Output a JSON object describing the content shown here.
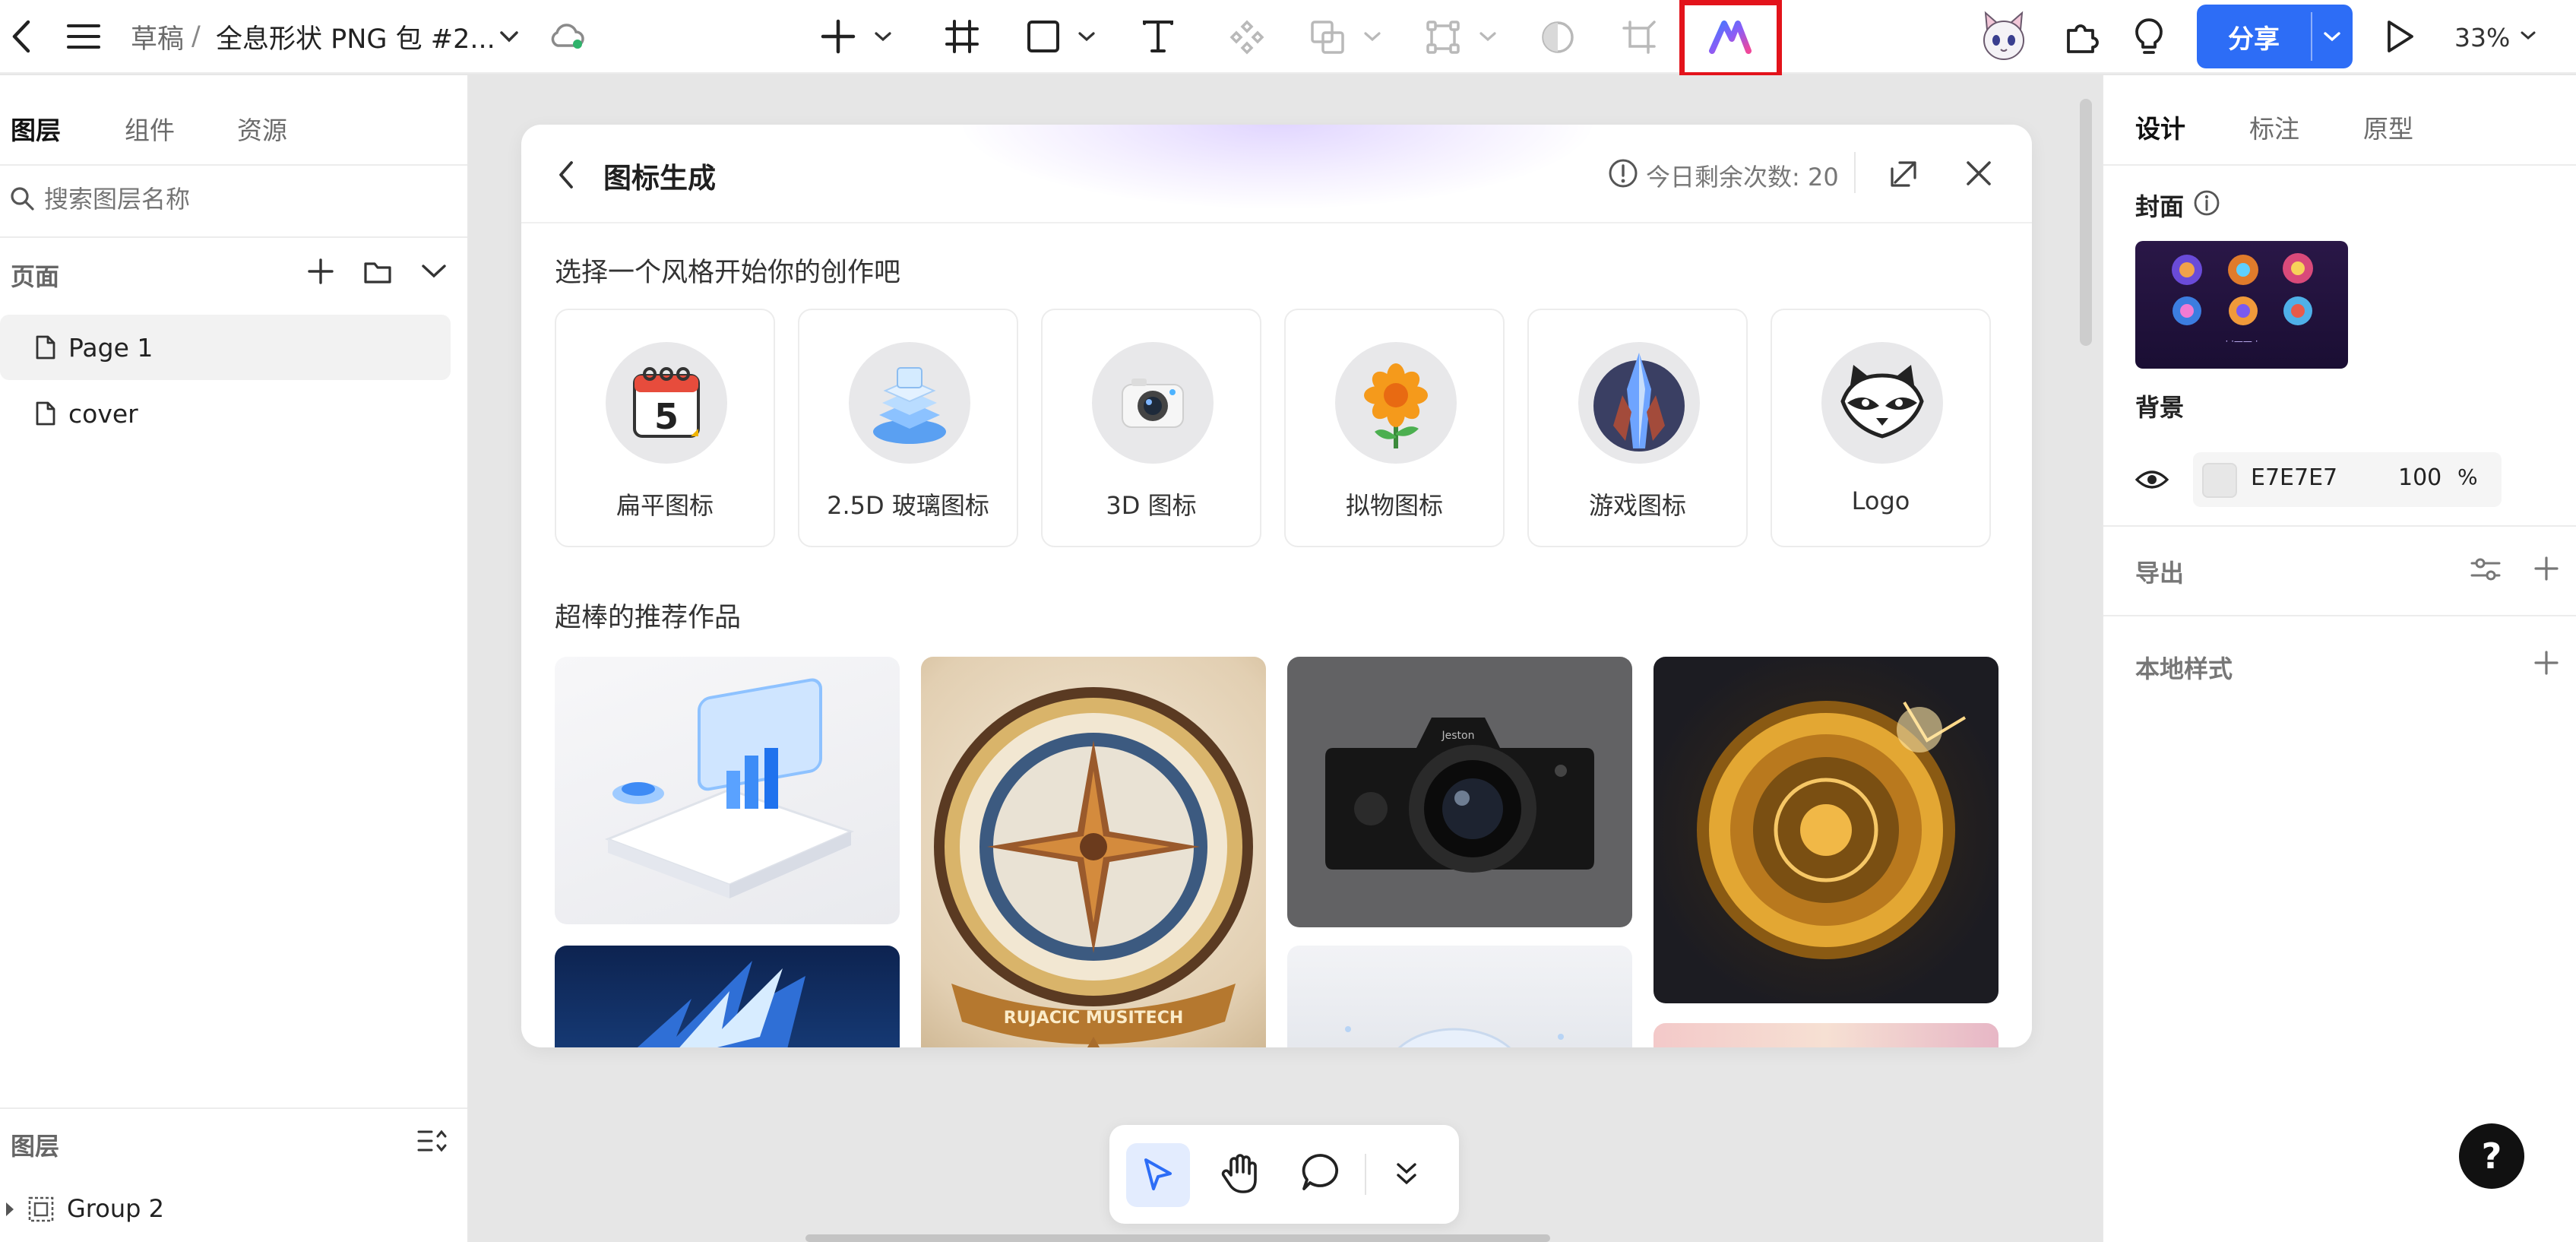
{
  "topbar": {
    "breadcrumb_drafts": "草稿",
    "breadcrumb_sep": "/",
    "file_name": "全息形状 PNG 包 #2...",
    "share_label": "分享",
    "zoom": "33%"
  },
  "left_panel": {
    "tabs": [
      {
        "label": "图层",
        "active": true
      },
      {
        "label": "组件",
        "active": false
      },
      {
        "label": "资源",
        "active": false
      }
    ],
    "search_placeholder": "搜索图层名称",
    "pages_title": "页面",
    "pages": [
      {
        "label": "Page 1",
        "selected": true
      },
      {
        "label": "cover",
        "selected": false
      }
    ],
    "layers_title": "图层",
    "layers": [
      {
        "label": "Group 2"
      }
    ]
  },
  "dialog": {
    "title": "图标生成",
    "remaining": "今日剩余次数: 20",
    "prompt": "选择一个风格开始你的创作吧",
    "styles": [
      {
        "label": "扁平图标",
        "icon": "calendar-icon"
      },
      {
        "label": "2.5D 玻璃图标",
        "icon": "glass-stack-icon"
      },
      {
        "label": "3D 图标",
        "icon": "camera-icon"
      },
      {
        "label": "拟物图标",
        "icon": "flower-icon"
      },
      {
        "label": "游戏图标",
        "icon": "crystal-icon"
      },
      {
        "label": "Logo",
        "icon": "raccoon-icon"
      }
    ],
    "recommend_title": "超棒的推荐作品",
    "recommended": [
      {
        "name": "glass-device-artwork"
      },
      {
        "name": "compass-artwork",
        "banner_text": "RUJACIC  MUSITECH"
      },
      {
        "name": "camera-artwork",
        "brand_text": "Jeston"
      },
      {
        "name": "golden-vault-artwork"
      },
      {
        "name": "blue-lightning-artwork"
      },
      {
        "name": "white-sphere-artwork"
      },
      {
        "name": "pink-artwork"
      }
    ]
  },
  "right_panel": {
    "tabs": [
      {
        "label": "设计",
        "active": true
      },
      {
        "label": "标注",
        "active": false
      },
      {
        "label": "原型",
        "active": false
      }
    ],
    "cover_title": "封面",
    "cover_caption": "· ·—— ·",
    "background_title": "背景",
    "background_hex": "E7E7E7",
    "background_opacity": "100",
    "background_opacity_unit": "%",
    "export_title": "导出",
    "local_styles_title": "本地样式"
  },
  "colors": {
    "accent": "#2d6df6",
    "highlight": "#e3131b",
    "canvas_bg": "#e6e6e6",
    "swatch": "#e7e7e7"
  }
}
